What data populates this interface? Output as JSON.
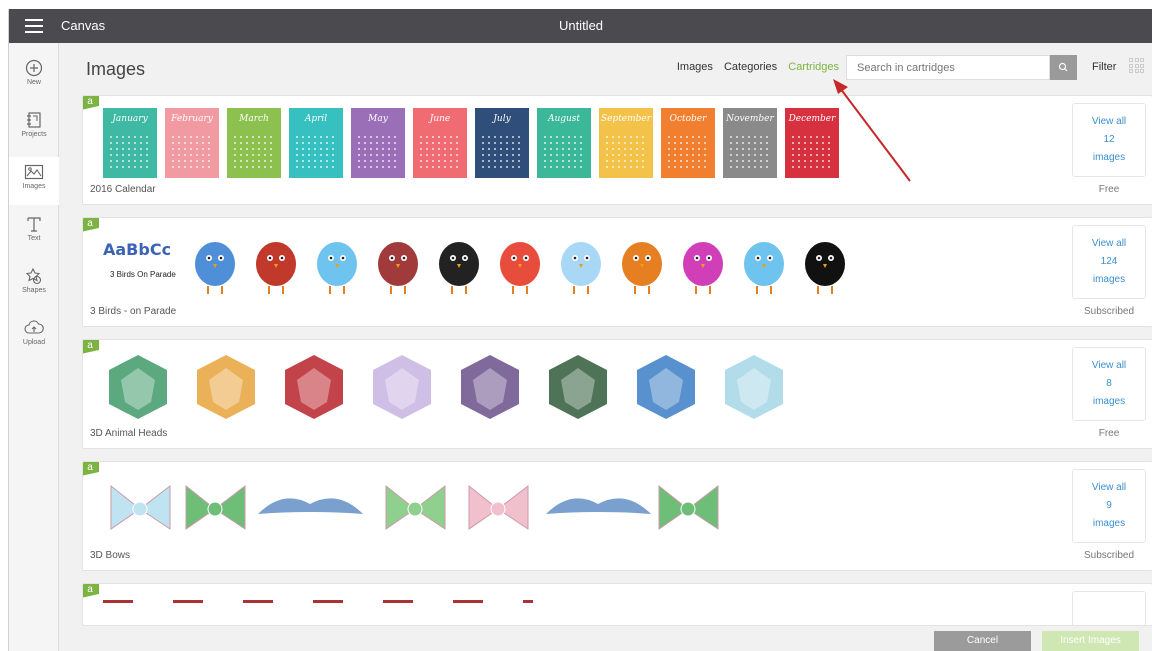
{
  "window": {
    "app_title": "Canvas",
    "doc_title": "Untitled"
  },
  "sidebar": {
    "items": [
      {
        "label": "New",
        "icon": "plus-circle-icon"
      },
      {
        "label": "Projects",
        "icon": "projects-icon"
      },
      {
        "label": "Images",
        "icon": "image-icon"
      },
      {
        "label": "Text",
        "icon": "text-icon"
      },
      {
        "label": "Shapes",
        "icon": "shapes-icon"
      },
      {
        "label": "Upload",
        "icon": "upload-icon"
      }
    ],
    "active": "Images"
  },
  "header": {
    "title": "Images",
    "tabs": [
      "Images",
      "Categories",
      "Cartridges"
    ],
    "active_tab": "Cartridges",
    "search_placeholder": "Search in cartridges",
    "filter_label": "Filter"
  },
  "cartridges": [
    {
      "name": "2016 Calendar",
      "view_all": "View all",
      "count": "12",
      "count_unit": "images",
      "status": "Free",
      "months": [
        "January",
        "February",
        "March",
        "April",
        "May",
        "June",
        "July",
        "August",
        "September",
        "October",
        "November",
        "December"
      ],
      "colors": [
        "#3fb8a4",
        "#f29aa1",
        "#8cc14f",
        "#36c0c0",
        "#9b6fb8",
        "#f06b72",
        "#2f4f7a",
        "#3bb89a",
        "#f3c248",
        "#f17f2f",
        "#8a8a8a",
        "#d7303f"
      ]
    },
    {
      "name": "3 Birds - on Parade",
      "view_all": "View all",
      "count": "124",
      "count_unit": "images",
      "status": "Subscribed",
      "sample_text": [
        "AaBbCc",
        "3 Birds On Parade"
      ],
      "colors": [
        "#3b63b8",
        "#4f8fd8",
        "#c0392b",
        "#6ec3ef",
        "#a13b3b",
        "#222222",
        "#e74c3c",
        "#a8d8f5",
        "#e67e22",
        "#d13fb8",
        "#6ec3ef",
        "#111111"
      ]
    },
    {
      "name": "3D Animal Heads",
      "view_all": "View all",
      "count": "8",
      "count_unit": "images",
      "status": "Free",
      "colors": [
        "#3f9a6a",
        "#e8a33b",
        "#b8222c",
        "#c7b3e0",
        "#6a4f8a",
        "#2f5a3a",
        "#3b7ec4",
        "#a6d6e6"
      ]
    },
    {
      "name": "3D Bows",
      "view_all": "View all",
      "count": "9",
      "count_unit": "images",
      "status": "Subscribed",
      "colors": [
        "#bfe3f0",
        "#6fbe78",
        "#7aa0d0",
        "#8fd08f",
        "#f0c0cc",
        "#7aa0d0",
        "#6fbe78"
      ]
    }
  ],
  "footer": {
    "cancel_label": "Cancel",
    "insert_label": "Insert Images"
  },
  "theme": {
    "accent": "#7cb342",
    "link": "#3b8fd0",
    "topbar": "#4b4b4f",
    "annotation_arrow": "#c62828"
  }
}
